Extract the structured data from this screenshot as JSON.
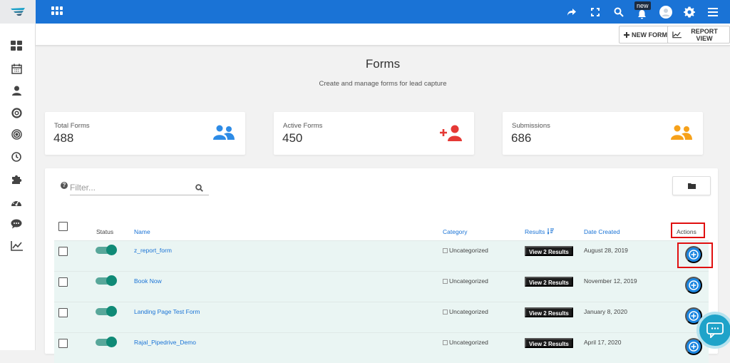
{
  "topbar": {
    "new_badge": "new",
    "icons": [
      "share-icon",
      "fullscreen-icon",
      "search-icon",
      "bell-icon",
      "user-avatar",
      "gear-icon",
      "hamburger-menu-icon"
    ],
    "color": "#1a73d6"
  },
  "sidebar": {
    "items": [
      "dashboard-icon",
      "calendar-icon",
      "person-icon",
      "support-icon",
      "target-icon",
      "clock-icon",
      "puzzle-icon",
      "speedometer-icon",
      "chat-icon",
      "chart-line-icon"
    ]
  },
  "toolbar": {
    "new_form_label": "NEW FORM",
    "report_view_label": "REPORT VIEW"
  },
  "page": {
    "title": "Forms",
    "subtitle": "Create and manage forms for lead capture"
  },
  "stats": [
    {
      "label": "Total Forms",
      "value": "488",
      "icon": "users-icon",
      "color": "#2d8be6"
    },
    {
      "label": "Active Forms",
      "value": "450",
      "icon": "add-user-icon",
      "color": "#e53935"
    },
    {
      "label": "Submissions",
      "value": "686",
      "icon": "users-icon",
      "color": "#f6a11a"
    }
  ],
  "filter": {
    "help": "?",
    "placeholder": "Filter..."
  },
  "table": {
    "columns": {
      "status": "Status",
      "name": "Name",
      "category": "Category",
      "results": "Results",
      "date_created": "Date Created",
      "actions": "Actions"
    },
    "rows": [
      {
        "name": "z_report_form",
        "category": "Uncategorized",
        "results": "View 2 Results",
        "date": "August 28, 2019",
        "active": true
      },
      {
        "name": "Book Now",
        "category": "Uncategorized",
        "results": "View 2 Results",
        "date": "November 12, 2019",
        "active": true
      },
      {
        "name": "Landing Page Test Form",
        "category": "Uncategorized",
        "results": "View 2 Results",
        "date": "January 8, 2020",
        "active": true
      },
      {
        "name": "Rajal_Pipedrive_Demo",
        "category": "Uncategorized",
        "results": "View 2 Results",
        "date": "April 17, 2020",
        "active": true
      }
    ]
  }
}
